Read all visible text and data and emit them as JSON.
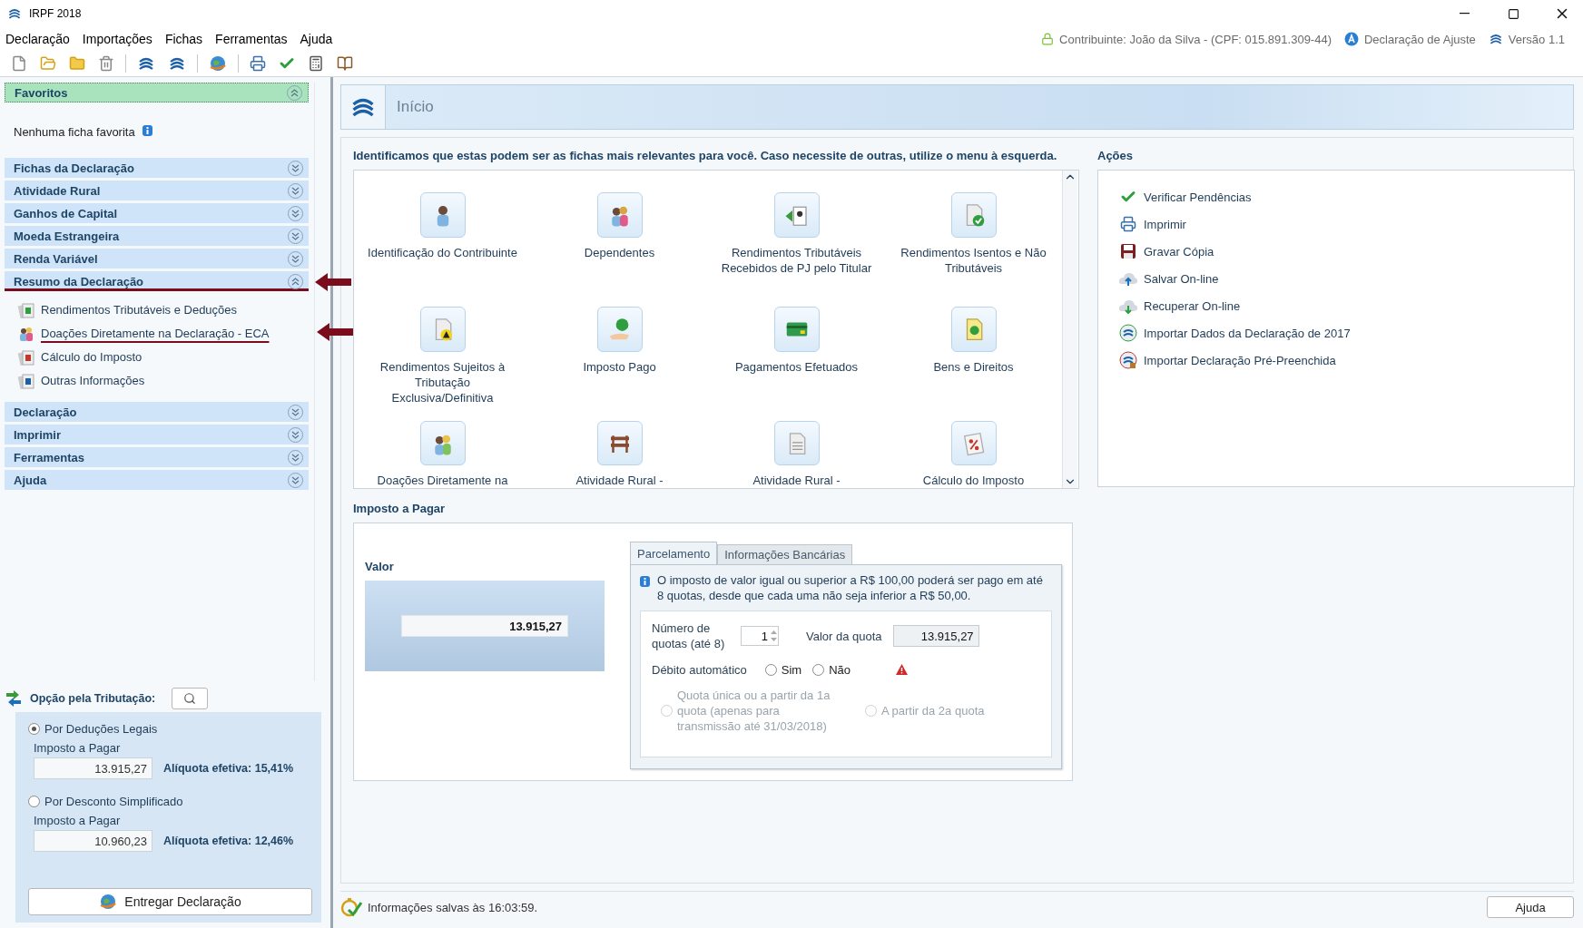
{
  "window": {
    "title": "IRPF 2018"
  },
  "menu": [
    "Declaração",
    "Importações",
    "Fichas",
    "Ferramentas",
    "Ajuda"
  ],
  "header_info": {
    "contribuinte": "Contribuinte: João da Silva - (CPF: 015.891.309-44)",
    "declaracao": "Declaração de Ajuste",
    "versao": "Versão 1.1"
  },
  "sidebar": {
    "favoritos": {
      "title": "Favoritos",
      "empty": "Nenhuma ficha favorita",
      "expanded": true
    },
    "sections": [
      {
        "title": "Fichas da Declaração",
        "expanded": false,
        "highlighted": false
      },
      {
        "title": "Atividade Rural",
        "expanded": false,
        "highlighted": false
      },
      {
        "title": "Ganhos de Capital",
        "expanded": false,
        "highlighted": false
      },
      {
        "title": "Moeda Estrangeira",
        "expanded": false,
        "highlighted": false
      },
      {
        "title": "Renda Variável",
        "expanded": false,
        "highlighted": false
      },
      {
        "title": "Resumo da Declaração",
        "expanded": true,
        "highlighted": true,
        "children": [
          {
            "label": "Rendimentos Tributáveis e Deduções",
            "highlighted": false
          },
          {
            "label": "Doações Diretamente na Declaração - ECA",
            "highlighted": true
          },
          {
            "label": "Cálculo do Imposto",
            "highlighted": false
          },
          {
            "label": "Outras Informações",
            "highlighted": false
          }
        ]
      },
      {
        "title": "Declaração",
        "expanded": false,
        "highlighted": false
      },
      {
        "title": "Imprimir",
        "expanded": false,
        "highlighted": false
      },
      {
        "title": "Ferramentas",
        "expanded": false,
        "highlighted": false
      },
      {
        "title": "Ajuda",
        "expanded": false,
        "highlighted": false
      }
    ]
  },
  "opcao": {
    "label": "Opção pela Tributação:",
    "options": [
      {
        "label": "Por Deduções Legais",
        "selected": true,
        "field_label": "Imposto a Pagar",
        "value": "13.915,27",
        "aliquota": "Alíquota efetiva: 15,41%"
      },
      {
        "label": "Por Desconto Simplificado",
        "selected": false,
        "field_label": "Imposto a Pagar",
        "value": "10.960,23",
        "aliquota": "Alíquota efetiva: 12,46%"
      }
    ],
    "button": "Entregar Declaração"
  },
  "header": {
    "title": "Início"
  },
  "fichas": {
    "intro": "Identificamos que estas podem ser as fichas mais relevantes para você. Caso necessite de outras, utilize o menu à esquerda.",
    "items": [
      "Identificação do Contribuinte",
      "Dependentes",
      "Rendimentos Tributáveis Recebidos de PJ pelo Titular",
      "Rendimentos Isentos e Não Tributáveis",
      "Rendimentos Sujeitos à Tributação Exclusiva/Definitiva",
      "Imposto Pago",
      "Pagamentos Efetuados",
      "Bens e Direitos",
      "Doações Diretamente na",
      "Atividade Rural -",
      "Atividade Rural -",
      "Cálculo do Imposto"
    ]
  },
  "acoes": {
    "title": "Ações",
    "items": [
      "Verificar Pendências",
      "Imprimir",
      "Gravar Cópia",
      "Salvar On-line",
      "Recuperar On-line",
      "Importar Dados da Declaração de 2017",
      "Importar Declaração Pré-Preenchida"
    ]
  },
  "imposto": {
    "title": "Imposto a Pagar",
    "valor_label": "Valor",
    "valor": "13.915,27",
    "tabs": [
      {
        "label": "Parcelamento",
        "selected": true
      },
      {
        "label": "Informações Bancárias",
        "selected": false
      }
    ],
    "info": "O imposto de valor igual ou superior a R$ 100,00 poderá ser pago em até 8 quotas, desde que cada uma não seja inferior a R$ 50,00.",
    "quotas_label": "Número de quotas (até 8)",
    "quotas": "1",
    "valor_quota_label": "Valor da quota",
    "valor_quota": "13.915,27",
    "debito_label": "Débito automático",
    "debito_options": [
      {
        "label": "Sim",
        "selected": false
      },
      {
        "label": "Não",
        "selected": false
      }
    ],
    "quota_options": [
      {
        "label": "Quota única ou a partir da 1a quota (apenas para transmissão até 31/03/2018)",
        "selected": false,
        "disabled": true
      },
      {
        "label": "A partir da 2a quota",
        "selected": false,
        "disabled": true
      }
    ]
  },
  "status_bar": {
    "message": "Informações salvas às 16:03:59.",
    "help_button": "Ajuda"
  }
}
